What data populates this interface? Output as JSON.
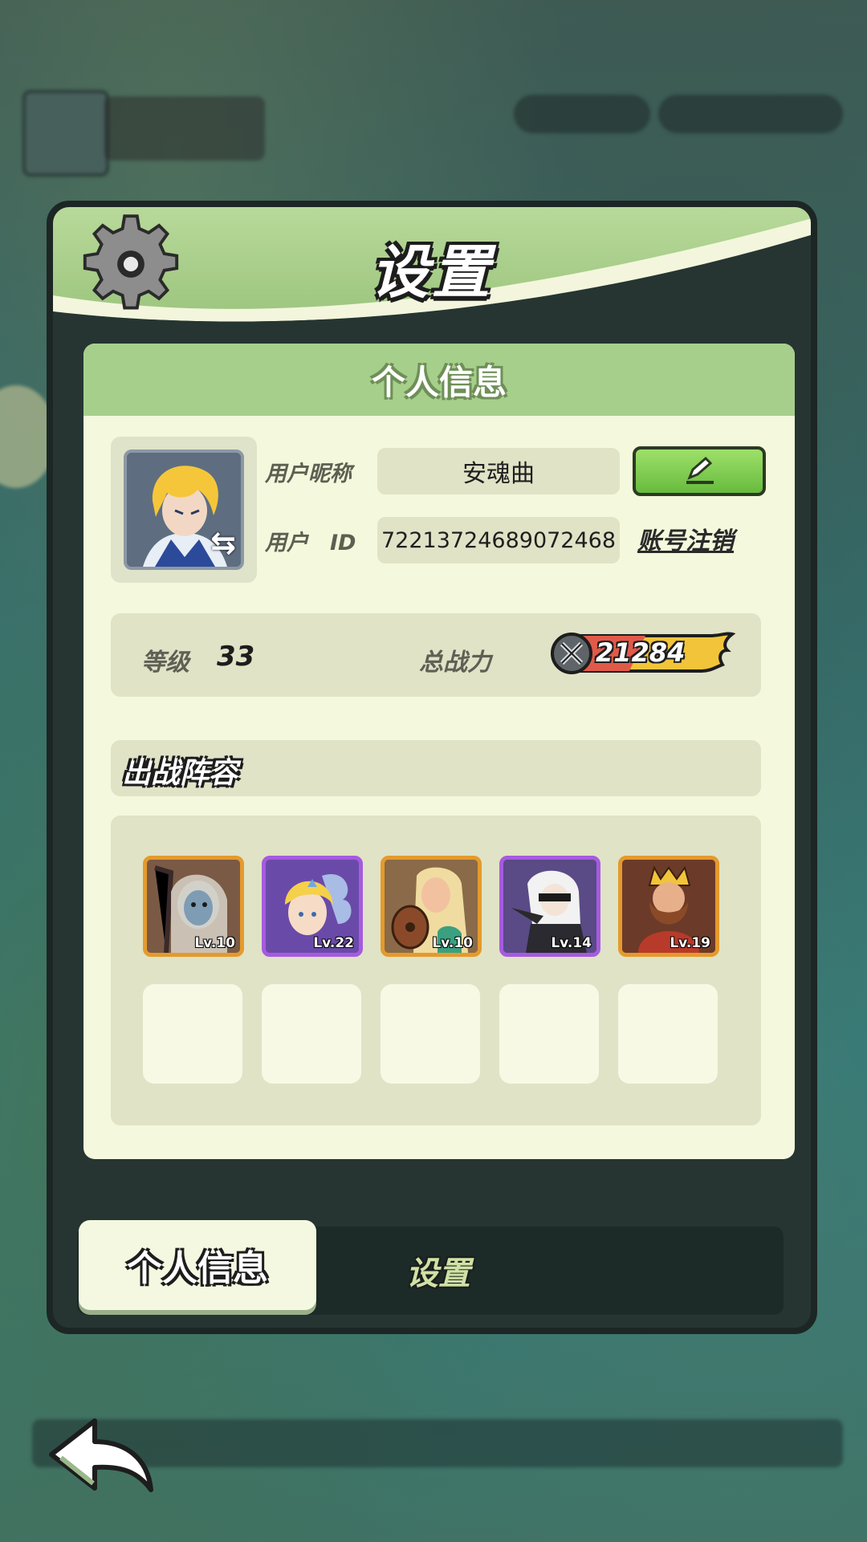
{
  "panel": {
    "title": "设置"
  },
  "profile": {
    "section_title": "个人信息",
    "nickname_label": "用户昵称",
    "nickname": "安魂曲",
    "id_label": "用户　ID",
    "user_id": "7221372468907246​8",
    "cancel_account_label": "账号注销",
    "edit_icon": "pencil-icon",
    "avatar_swap_icon": "swap-arrows-icon"
  },
  "stats": {
    "level_label": "等级",
    "level": "33",
    "power_label": "总战力",
    "power": "21284"
  },
  "lineup": {
    "title": "出战阵容",
    "heroes": [
      {
        "level": "Lv.10",
        "frame": "orange"
      },
      {
        "level": "Lv.22",
        "frame": "purple"
      },
      {
        "level": "Lv.10",
        "frame": "orange"
      },
      {
        "level": "Lv.14",
        "frame": "purple"
      },
      {
        "level": "Lv.19",
        "frame": "orange"
      }
    ],
    "empty_slots": 5
  },
  "tabs": {
    "active": "个人信息",
    "inactive": "设置"
  },
  "colors": {
    "header_green": "#a7cf8c",
    "card_bg": "#f4f8dc",
    "frame_orange": "#e59a2c",
    "frame_purple": "#a65ae0",
    "edit_green": "#67bb3e"
  }
}
